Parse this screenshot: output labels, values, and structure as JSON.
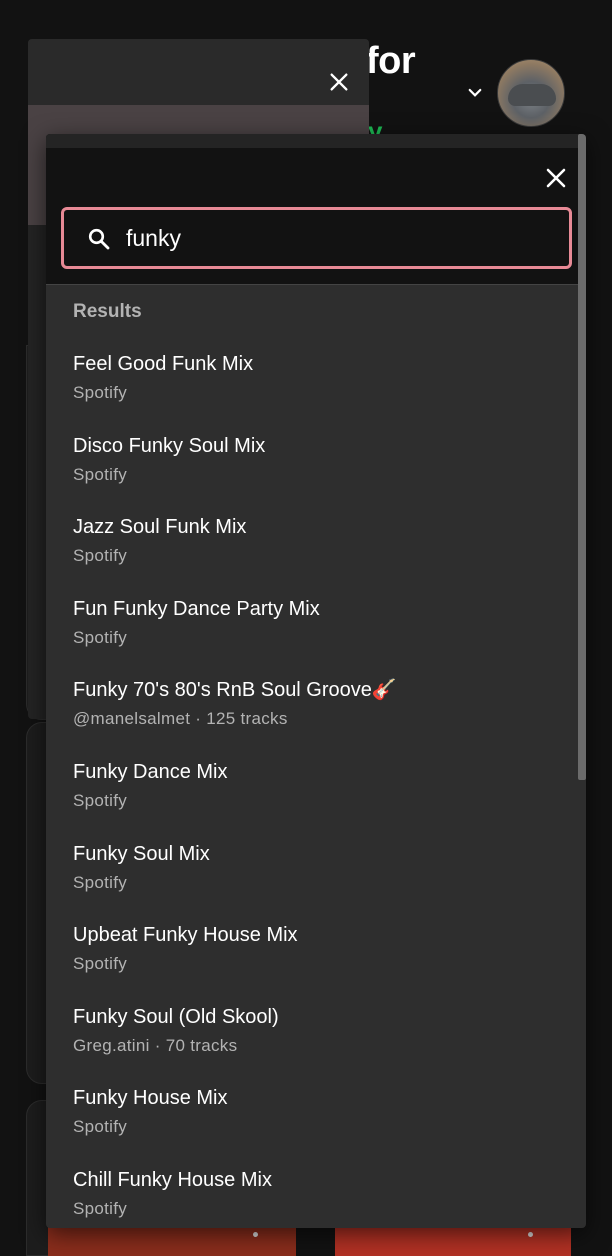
{
  "background": {
    "title_fragment": "for",
    "green_fragment": "y"
  },
  "search_dialog": {
    "query": "funky",
    "results_heading": "Results",
    "results": [
      {
        "title": "Feel Good Funk Mix",
        "subtitle": "Spotify"
      },
      {
        "title": "Disco Funky Soul Mix",
        "subtitle": "Spotify"
      },
      {
        "title": "Jazz Soul Funk Mix",
        "subtitle": "Spotify"
      },
      {
        "title": "Fun Funky Dance Party Mix",
        "subtitle": "Spotify"
      },
      {
        "title": "Funky 70's 80's RnB Soul Groove🎸",
        "subtitle": "@manelsalmet · 125 tracks"
      },
      {
        "title": "Funky Dance Mix",
        "subtitle": "Spotify"
      },
      {
        "title": "Funky Soul Mix",
        "subtitle": "Spotify"
      },
      {
        "title": "Upbeat Funky House Mix",
        "subtitle": "Spotify"
      },
      {
        "title": "Funky Soul (Old Skool)",
        "subtitle": "Greg.atini · 70 tracks"
      },
      {
        "title": "Funky House Mix",
        "subtitle": "Spotify"
      },
      {
        "title": "Chill Funky House Mix",
        "subtitle": "Spotify"
      }
    ]
  },
  "icons": {
    "close": "close-icon",
    "search": "search-icon",
    "chevron": "chevron-down-icon"
  },
  "colors": {
    "focus_ring": "#e88a96",
    "brand_green": "#1db954"
  }
}
